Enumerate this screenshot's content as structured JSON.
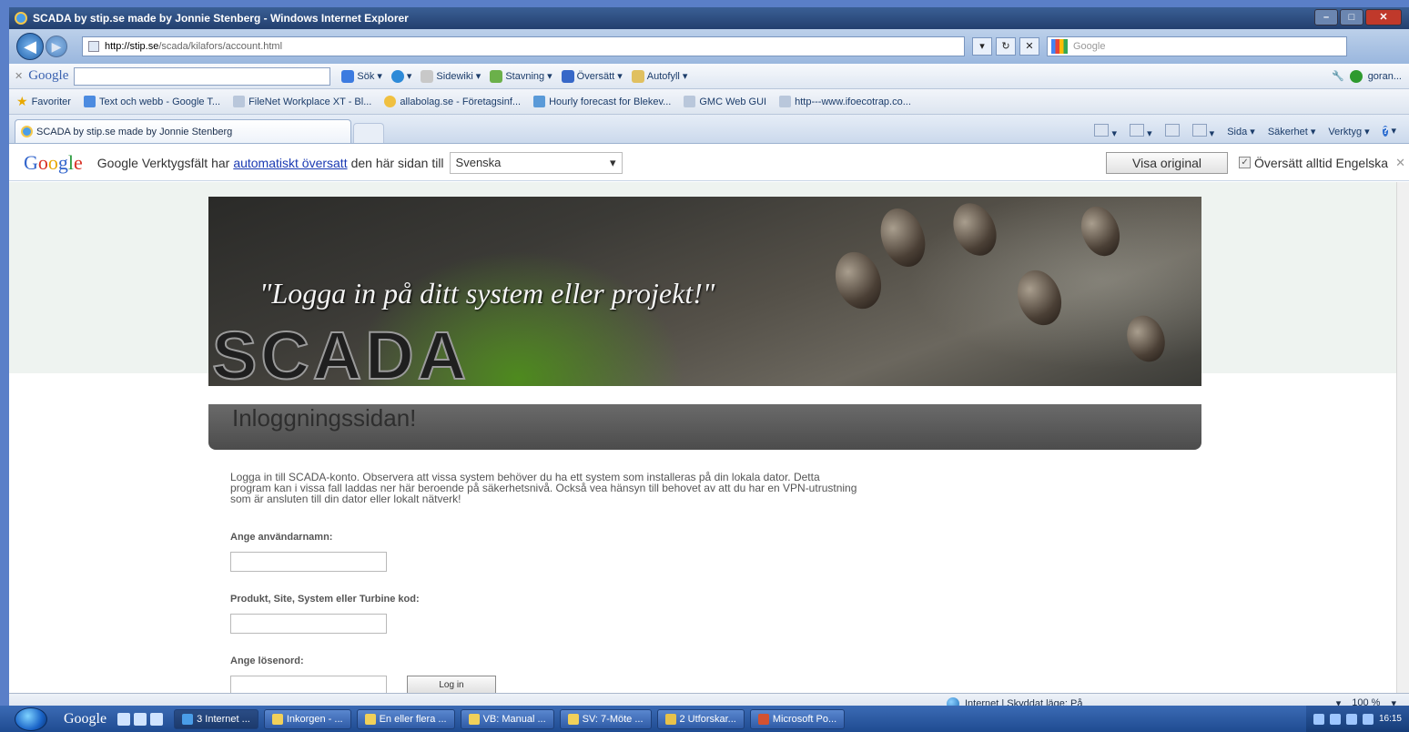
{
  "window": {
    "title": "SCADA by stip.se made by Jonnie Stenberg - Windows Internet Explorer"
  },
  "address_bar": {
    "url_domain": "http://stip.se",
    "url_path": "/scada/kilafors/account.html",
    "search_placeholder": "Google"
  },
  "google_toolbar": {
    "logo": "Google",
    "buttons": [
      "Sök",
      "Sidewiki",
      "Stavning",
      "Översätt",
      "Autofyll"
    ],
    "user": "goran..."
  },
  "favorites_bar": {
    "label": "Favoriter",
    "items": [
      "Text och webb - Google T...",
      "FileNet Workplace XT - Bl...",
      "allabolag.se - Företagsinf...",
      "Hourly forecast for Blekev...",
      "GMC Web GUI",
      "http---www.ifoecotrap.co..."
    ]
  },
  "tabs": {
    "active_label": "SCADA by stip.se made by Jonnie Stenberg",
    "commands": [
      "Sida",
      "Säkerhet",
      "Verktyg"
    ]
  },
  "translate_bar": {
    "logo": "Google",
    "prefix": "Google Verktygsfält har",
    "link": "automatiskt översatt",
    "suffix": "den här sidan till",
    "language": "Svenska",
    "show_original": "Visa original",
    "always_translate": "Översätt alltid Engelska"
  },
  "page": {
    "banner_quote": "\"Logga in på ditt system eller projekt!\"",
    "banner_brand": "SCADA",
    "heading": "Inloggningssidan!",
    "intro": "Logga in till SCADA-konto. Observera att vissa system behöver du ha ett system som installeras på din lokala dator. Detta program kan i vissa fall laddas ner här beroende på säkerhetsnivå. Också vea hänsyn till behovet av att du har en VPN-utrustning som är ansluten till din dator eller lokalt nätverk!",
    "username_label": "Ange användarnamn:",
    "project_label": "Produkt, Site, System eller Turbine kod:",
    "password_label": "Ange lösenord:",
    "login_button": "Log in"
  },
  "status_bar": {
    "zone": "Internet | Skyddat läge: På",
    "zoom": "100 %"
  },
  "taskbar": {
    "google": "Google",
    "tasks": [
      "3 Internet ...",
      "Inkorgen - ...",
      "En eller flera ...",
      "VB: Manual ...",
      "SV: 7-Möte ...",
      "2 Utforskar...",
      "Microsoft Po..."
    ],
    "clock": "16:15"
  },
  "colors": {
    "title_bar": "#233f6e",
    "header_bar": "#4c4c4c",
    "link": "#1a3ab3"
  }
}
